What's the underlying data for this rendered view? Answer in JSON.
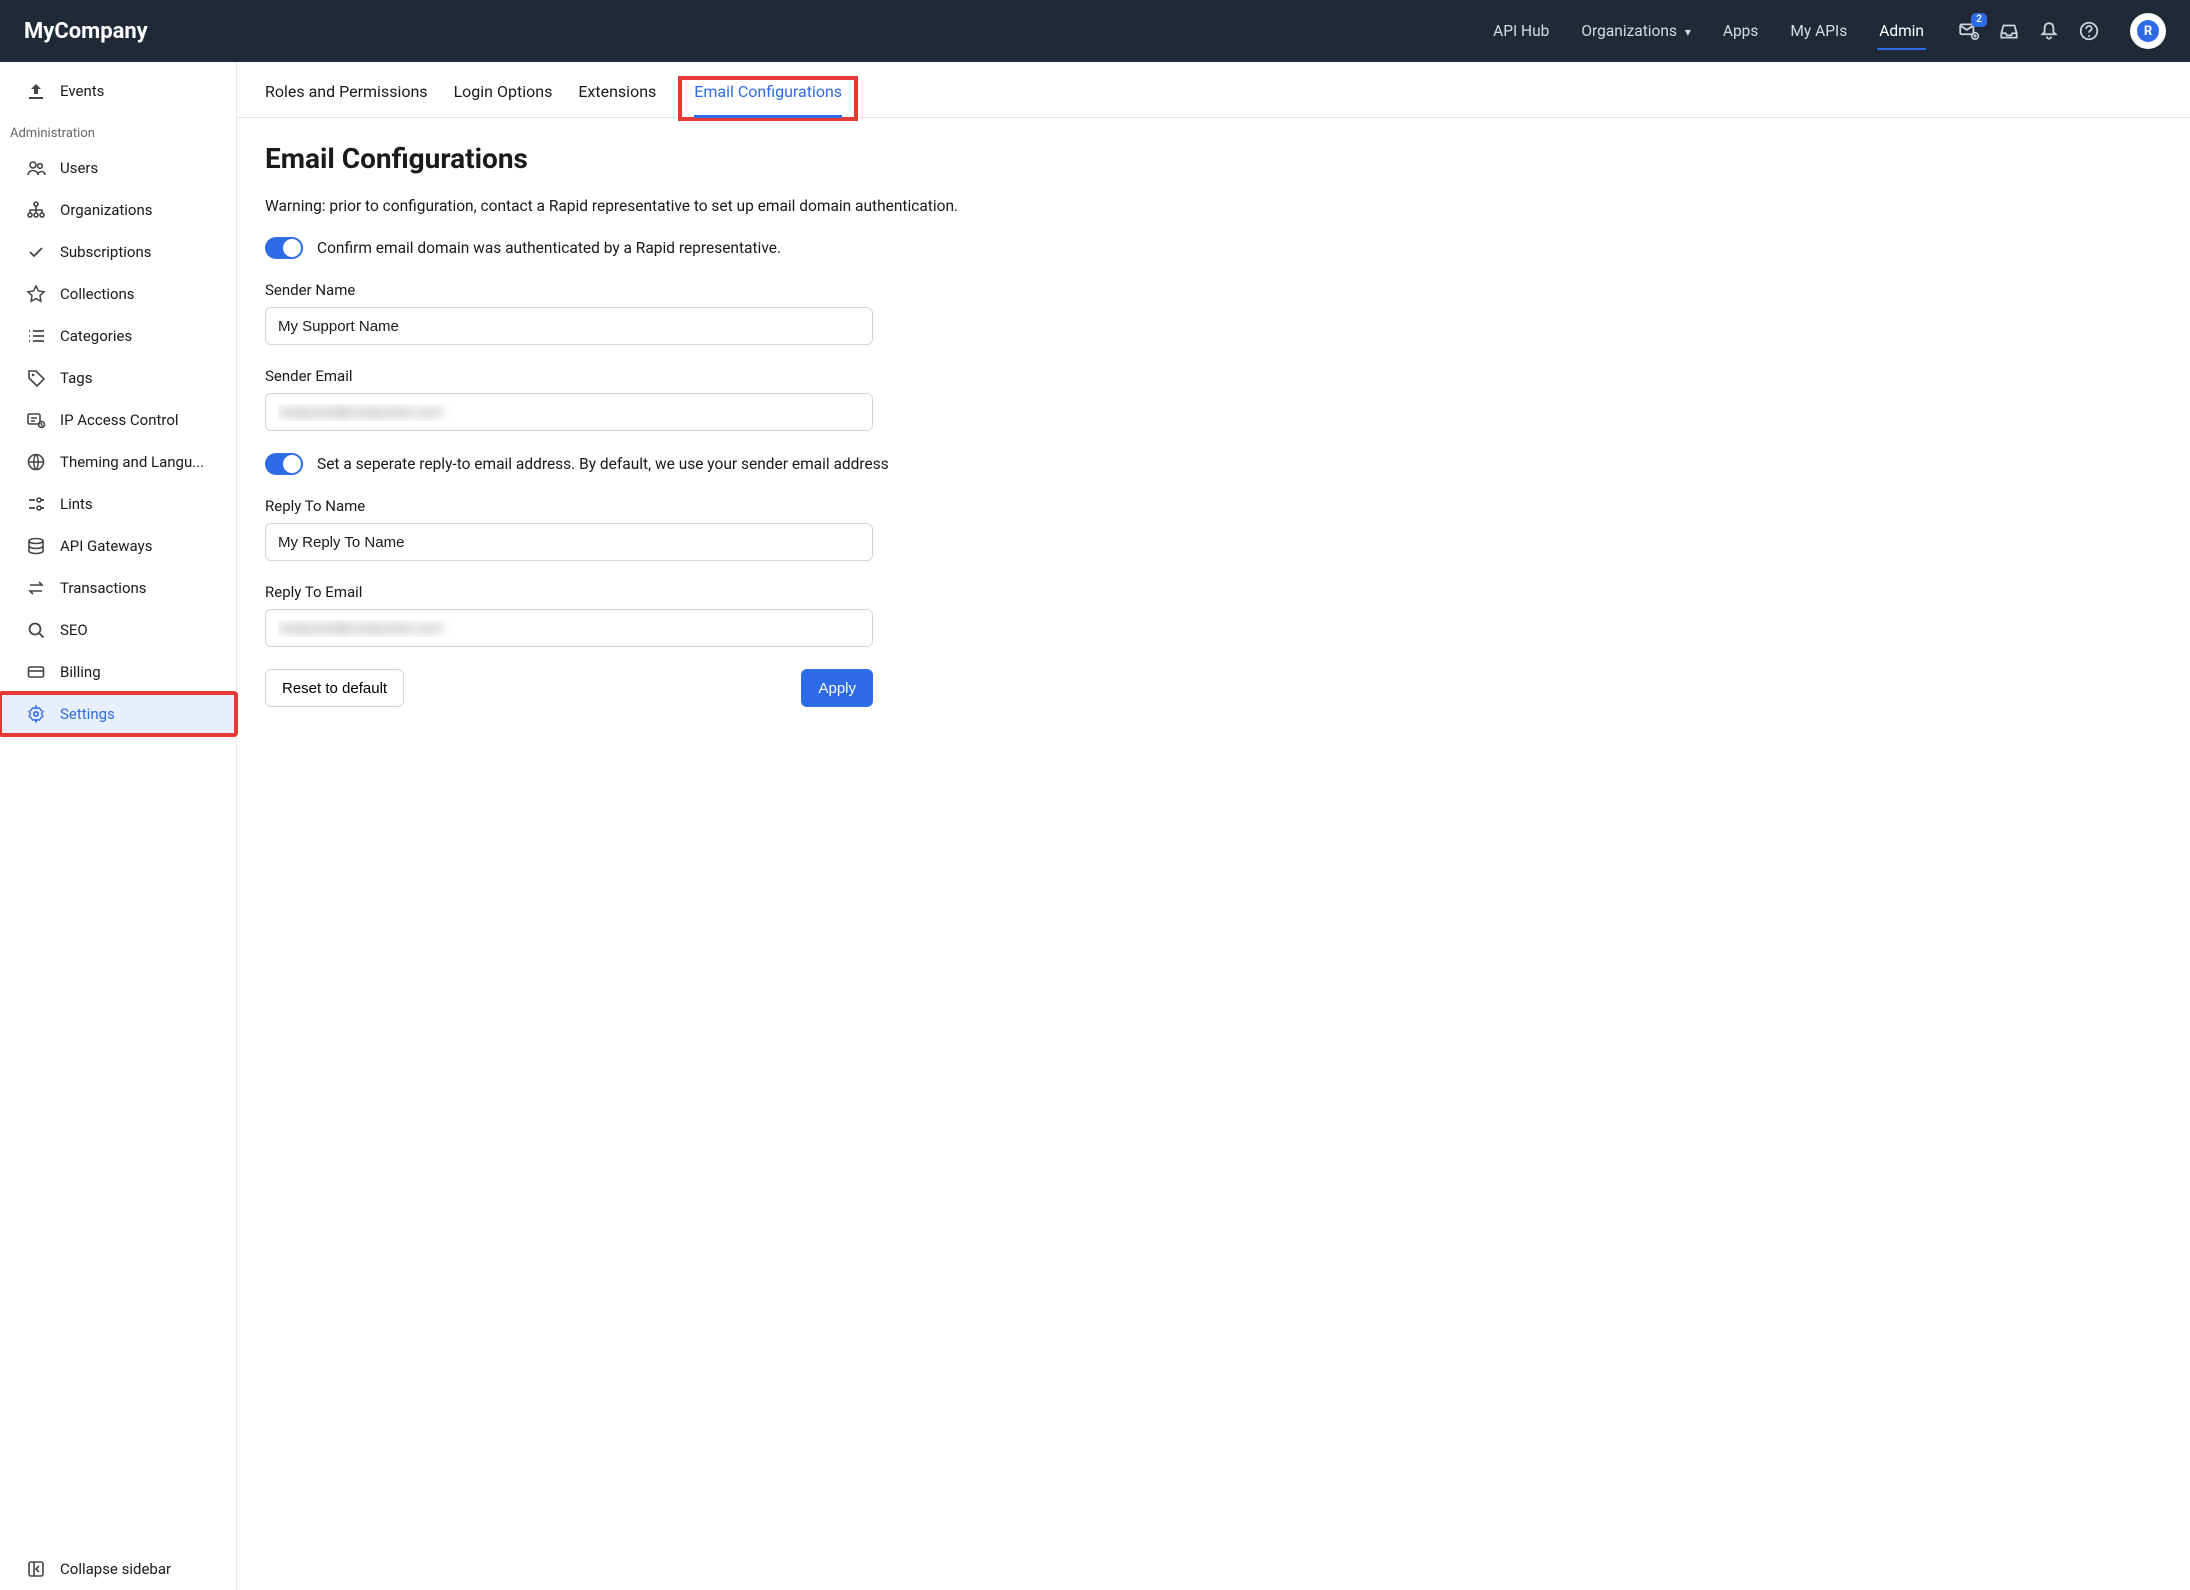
{
  "brand": "MyCompany",
  "topnav": {
    "items": [
      {
        "label": "API Hub",
        "active": false
      },
      {
        "label": "Organizations",
        "active": false,
        "dropdown": true
      },
      {
        "label": "Apps",
        "active": false
      },
      {
        "label": "My APIs",
        "active": false
      },
      {
        "label": "Admin",
        "active": true
      }
    ],
    "badge_count": "2"
  },
  "sidebar": {
    "top": {
      "label": "Events"
    },
    "section_label": "Administration",
    "items": [
      {
        "label": "Users",
        "icon": "users"
      },
      {
        "label": "Organizations",
        "icon": "org"
      },
      {
        "label": "Subscriptions",
        "icon": "check"
      },
      {
        "label": "Collections",
        "icon": "star"
      },
      {
        "label": "Categories",
        "icon": "list"
      },
      {
        "label": "Tags",
        "icon": "tag"
      },
      {
        "label": "IP Access Control",
        "icon": "ipaccess"
      },
      {
        "label": "Theming and Langu...",
        "icon": "globe"
      },
      {
        "label": "Lints",
        "icon": "lints"
      },
      {
        "label": "API Gateways",
        "icon": "db"
      },
      {
        "label": "Transactions",
        "icon": "transactions"
      },
      {
        "label": "SEO",
        "icon": "search"
      },
      {
        "label": "Billing",
        "icon": "card"
      },
      {
        "label": "Settings",
        "icon": "gear",
        "active": true,
        "highlight": true
      }
    ],
    "collapse_label": "Collapse sidebar"
  },
  "tabs": [
    {
      "label": "Roles and Permissions",
      "active": false
    },
    {
      "label": "Login Options",
      "active": false
    },
    {
      "label": "Extensions",
      "active": false
    },
    {
      "label": "Email Configurations",
      "active": true,
      "highlight": true
    }
  ],
  "page": {
    "title": "Email Configurations",
    "warning": "Warning: prior to configuration, contact a Rapid representative to set up email domain authentication.",
    "confirm_toggle_label": "Confirm email domain was authenticated by a Rapid representative.",
    "confirm_toggle_on": true,
    "sender_name_label": "Sender Name",
    "sender_name_value": "My Support Name",
    "sender_email_label": "Sender Email",
    "sender_email_value": "redacted@redacted.com",
    "replyto_toggle_label": "Set a seperate reply-to email address. By default, we use your sender email address",
    "replyto_toggle_on": true,
    "replyto_name_label": "Reply To Name",
    "replyto_name_value": "My Reply To Name",
    "replyto_email_label": "Reply To Email",
    "replyto_email_value": "redacted@redacted.com",
    "reset_label": "Reset to default",
    "apply_label": "Apply"
  }
}
